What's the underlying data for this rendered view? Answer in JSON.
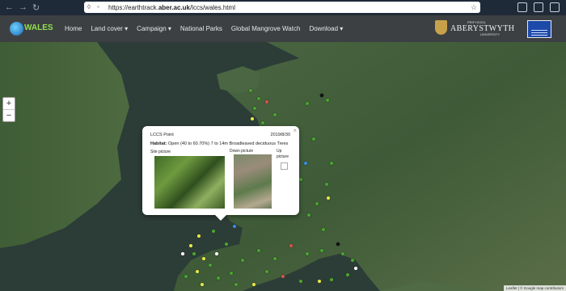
{
  "browser": {
    "url_prefix": "https://earthtrack.",
    "url_domain": "aber.ac.uk",
    "url_path": "/lccs/wales.html"
  },
  "site": {
    "logo_text": "WALES",
    "menu": [
      "Home",
      "Land cover ▾",
      "Campaign ▾",
      "National Parks",
      "Global Mangrove Watch",
      "Download ▾"
    ],
    "university_name": "ABERYSTWYTH",
    "university_welsh": "PRIFYSGOL",
    "university_sub": "UNIVERSITY"
  },
  "map": {
    "zoom_in": "+",
    "zoom_out": "−",
    "attribution": "Leaflet | © Google map contributors"
  },
  "popup": {
    "close": "×",
    "title": "LCCS Point",
    "date": "2019/8/30",
    "habitat_label": "Habitat:",
    "habitat_value": " Open (40 to 60.70%) 7 to 14m Broadleaved deciduous Trees",
    "site_label": "Site picture",
    "down_label": "Down picture",
    "up_label": "Up picture"
  },
  "colors": {
    "navbar": "#3d4043",
    "sea": "#2e3f35",
    "land": "#3f5a3a",
    "point_green": "#4aa52e",
    "point_yellow": "#e6e84a",
    "point_white": "#ffffff",
    "point_red": "#d9534f",
    "point_blue": "#3a8fe0",
    "point_black": "#111111"
  }
}
